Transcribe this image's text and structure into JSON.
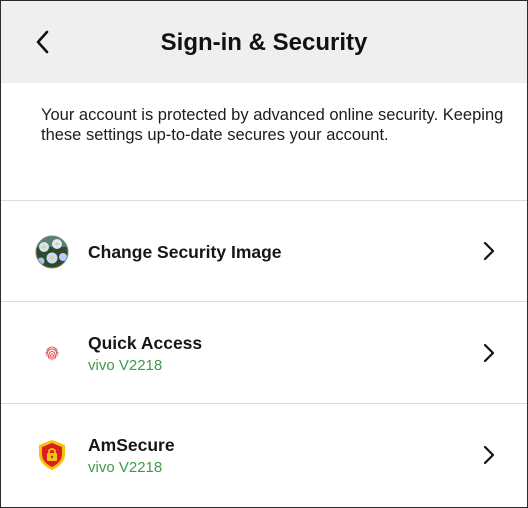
{
  "header": {
    "title": "Sign-in & Security",
    "back_icon": "chevron-left-icon"
  },
  "intro": {
    "text": "Your account is protected by advanced online security. Keeping these settings up-to-date secures your account."
  },
  "items": [
    {
      "label": "Change Security Image",
      "subtitle": "",
      "icon": "security-image-icon",
      "chevron": "chevron-right-icon"
    },
    {
      "label": "Quick Access",
      "subtitle": "vivo V2218",
      "icon": "fingerprint-icon",
      "chevron": "chevron-right-icon"
    },
    {
      "label": "AmSecure",
      "subtitle": "vivo V2218",
      "icon": "shield-lock-icon",
      "chevron": "chevron-right-icon"
    }
  ],
  "colors": {
    "header_bg": "#efefef",
    "subtitle_green": "#3e9a48",
    "divider": "#dcdcdc",
    "shield_red": "#d81e1e",
    "shield_yellow": "#f4c20d"
  }
}
